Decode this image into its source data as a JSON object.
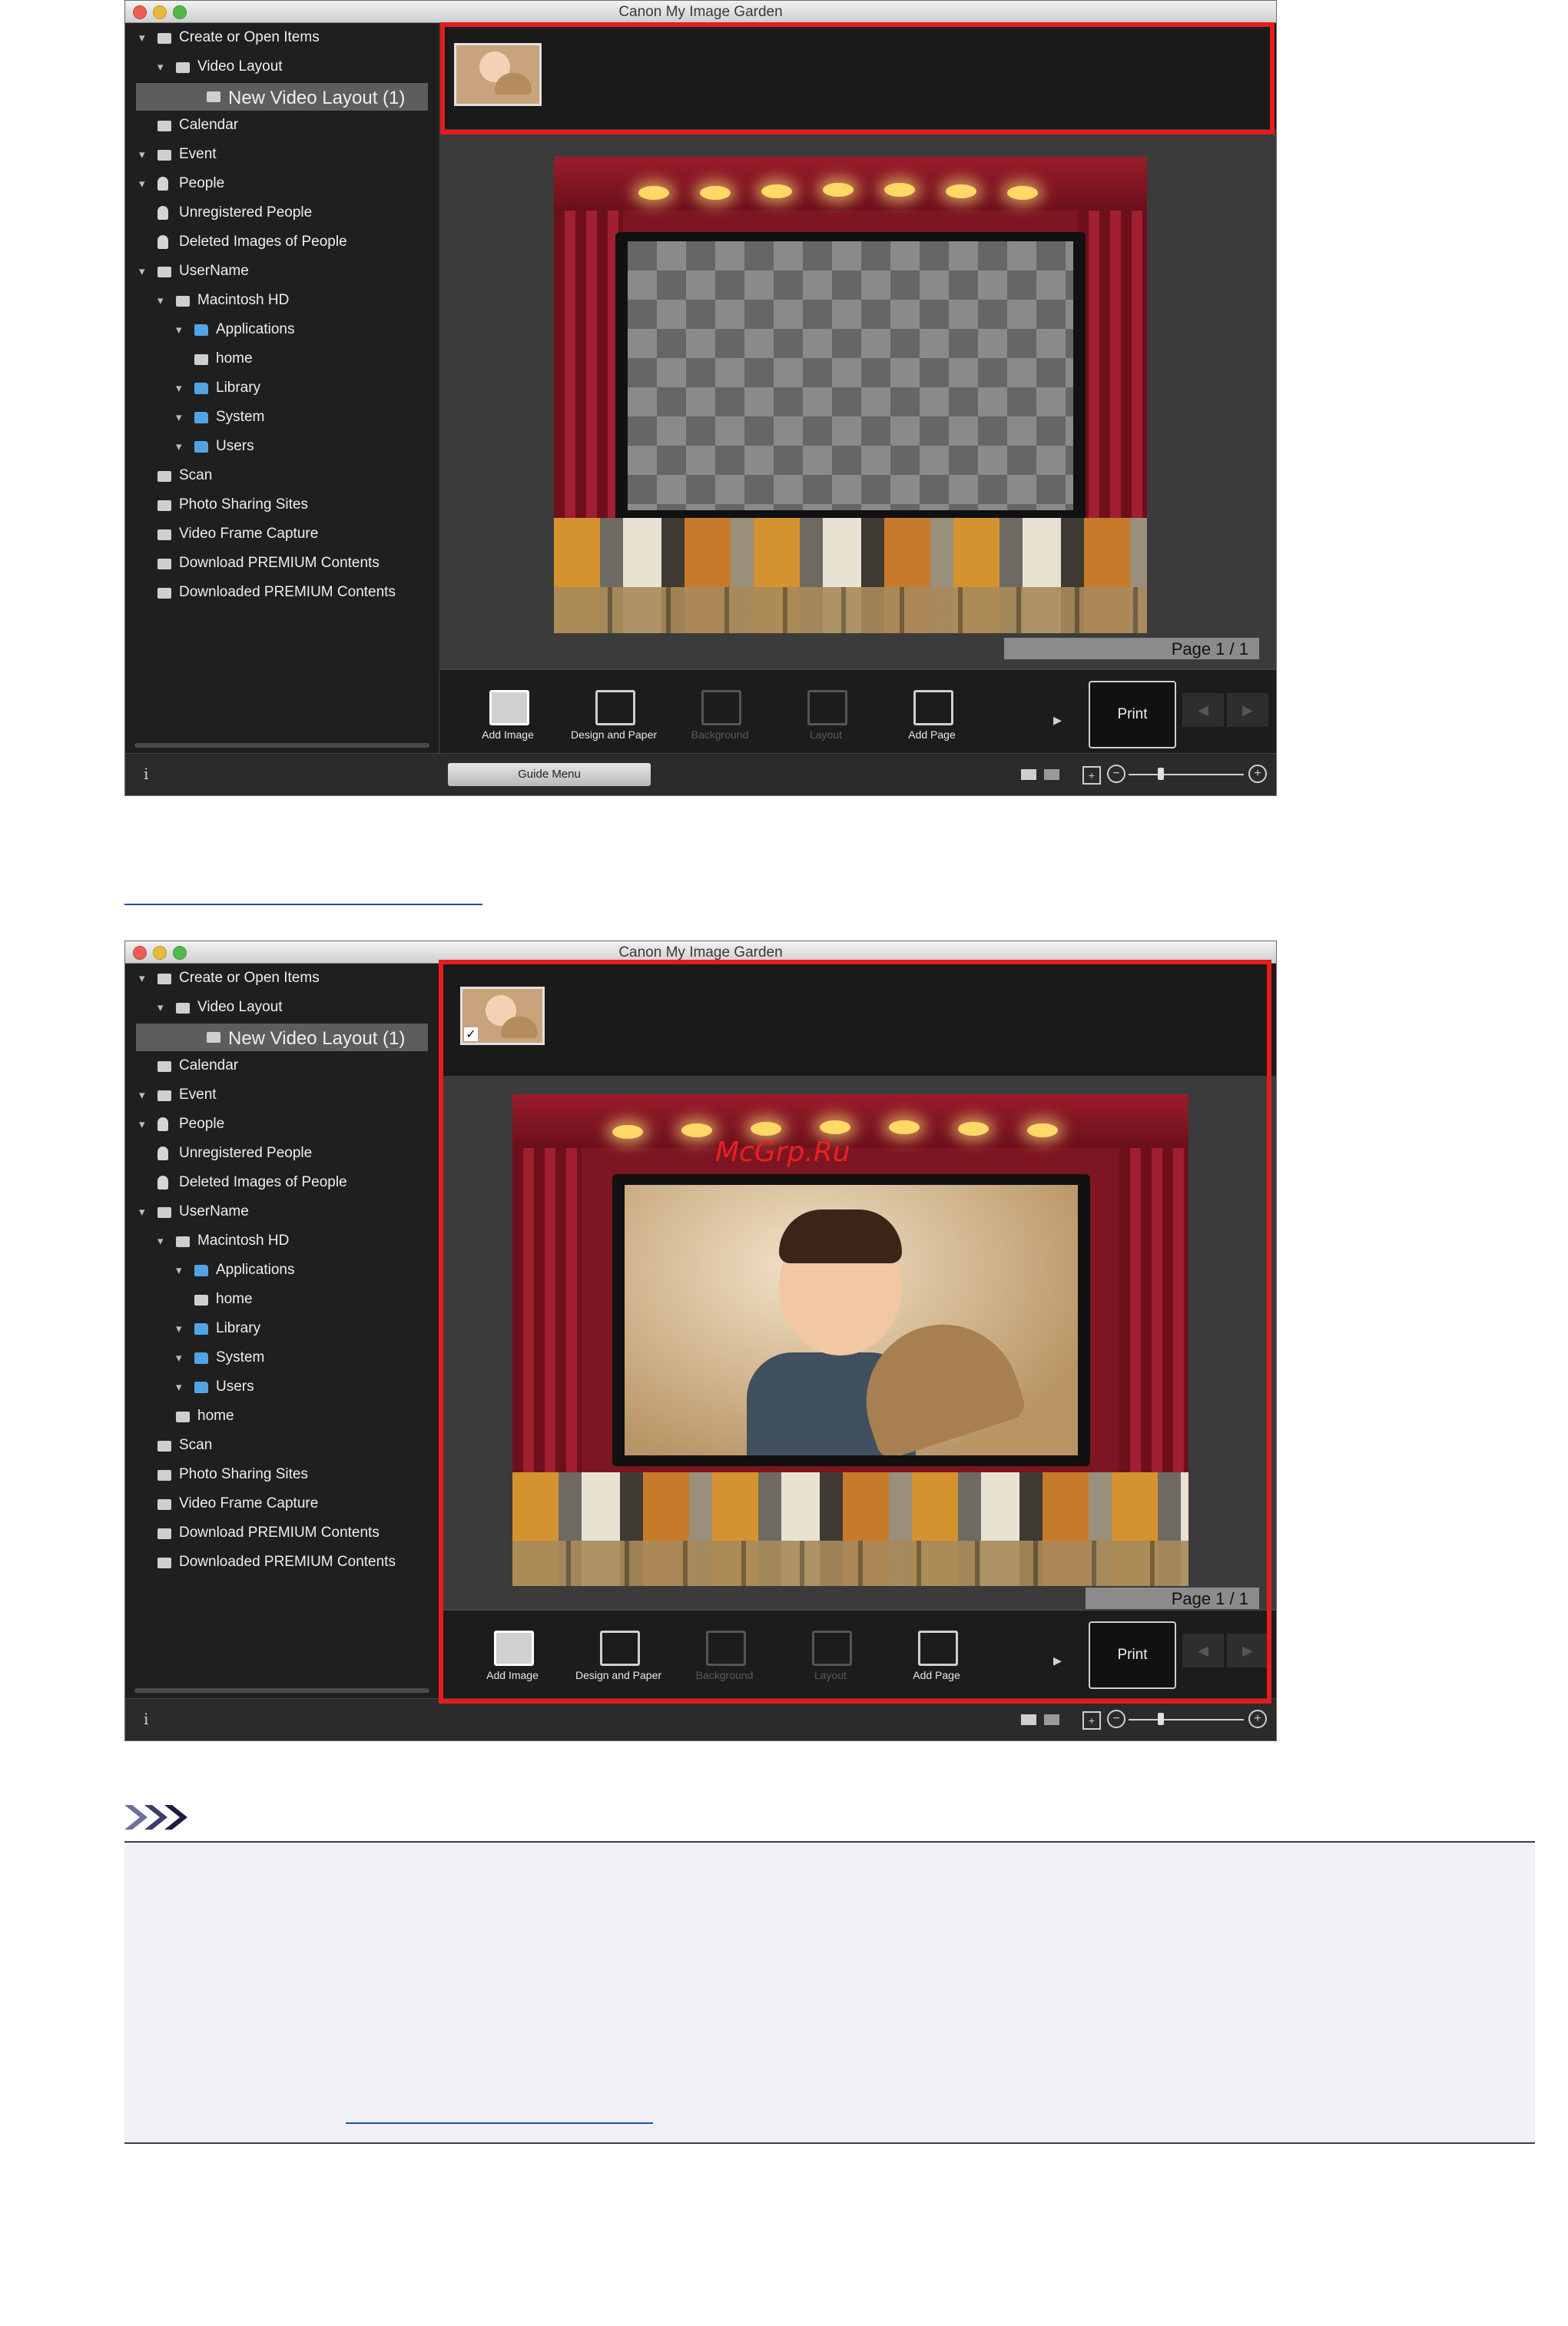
{
  "window": {
    "title": "Canon My Image Garden"
  },
  "sidebar": {
    "items_top": [
      {
        "label": "Create or Open Items"
      },
      {
        "label": "Video Layout"
      },
      {
        "label": "New Video Layout (1)"
      },
      {
        "label": "Calendar"
      },
      {
        "label": "Event"
      },
      {
        "label": "People"
      },
      {
        "label": "Unregistered People"
      },
      {
        "label": "Deleted Images of People"
      },
      {
        "label": "UserName"
      },
      {
        "label": "Macintosh HD"
      },
      {
        "label": "Applications"
      },
      {
        "label": "home"
      },
      {
        "label": "Library"
      },
      {
        "label": "System"
      },
      {
        "label": "Users"
      },
      {
        "label": "Scan"
      },
      {
        "label": "Photo Sharing Sites"
      },
      {
        "label": "Video Frame Capture"
      },
      {
        "label": "Download PREMIUM Contents"
      },
      {
        "label": "Downloaded PREMIUM Contents"
      }
    ],
    "items_bottom": [
      {
        "label": "Create or Open Items"
      },
      {
        "label": "Video Layout"
      },
      {
        "label": "New Video Layout (1)"
      },
      {
        "label": "Calendar"
      },
      {
        "label": "Event"
      },
      {
        "label": "People"
      },
      {
        "label": "Unregistered People"
      },
      {
        "label": "Deleted Images of People"
      },
      {
        "label": "UserName"
      },
      {
        "label": "Macintosh HD"
      },
      {
        "label": "Applications"
      },
      {
        "label": "home"
      },
      {
        "label": "Library"
      },
      {
        "label": "System"
      },
      {
        "label": "Users"
      },
      {
        "label": "home"
      },
      {
        "label": "Scan"
      },
      {
        "label": "Photo Sharing Sites"
      },
      {
        "label": "Video Frame Capture"
      },
      {
        "label": "Download PREMIUM Contents"
      },
      {
        "label": "Downloaded PREMIUM Contents"
      }
    ]
  },
  "canvas": {
    "page_label": "Page 1 / 1"
  },
  "toolbar": {
    "add_image": "Add Image",
    "design_and_paper": "Design and Paper",
    "background": "Background",
    "layout": "Layout",
    "add_page": "Add Page",
    "print": "Print"
  },
  "statusbar": {
    "guide_menu": "Guide Menu",
    "info": "i"
  },
  "watermark": "McGrp.Ru",
  "colors": {
    "highlight": "#e51c1c",
    "sidebar_bg": "#1f1f1f",
    "folder": "#52a3e3",
    "link": "#1a4fb3"
  },
  "icons": [
    "disclosure-triangle-icon",
    "folder-icon",
    "drive-icon",
    "person-icon",
    "calendar-icon",
    "scan-icon",
    "add-image-icon",
    "design-paper-icon",
    "background-icon",
    "layout-icon",
    "add-page-icon",
    "prev-page-icon",
    "next-page-icon",
    "info-icon",
    "zoom-in-icon",
    "zoom-out-icon",
    "note-icon"
  ]
}
